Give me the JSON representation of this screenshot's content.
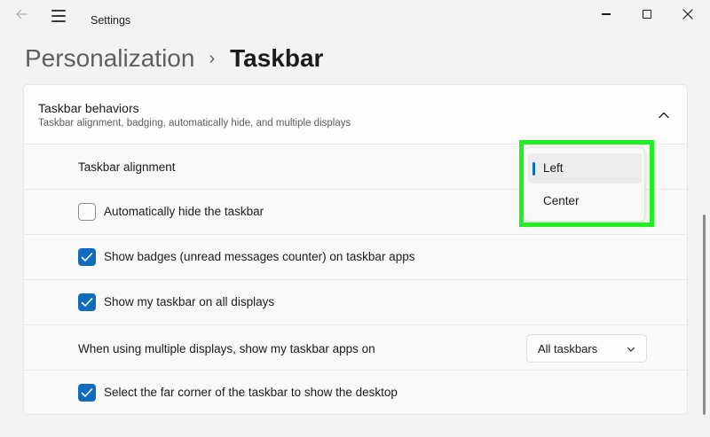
{
  "window": {
    "title": "Settings"
  },
  "breadcrumb": {
    "parent": "Personalization",
    "separator": "›",
    "current": "Taskbar"
  },
  "section": {
    "title": "Taskbar behaviors",
    "subtitle": "Taskbar alignment, badging, automatically hide, and multiple displays",
    "expanded": true
  },
  "rows": [
    {
      "label": "Taskbar alignment",
      "type": "dropdown"
    },
    {
      "label": "Automatically hide the taskbar",
      "type": "checkbox",
      "checked": false
    },
    {
      "label": "Show badges (unread messages counter) on taskbar apps",
      "type": "checkbox",
      "checked": true
    },
    {
      "label": "Show my taskbar on all displays",
      "type": "checkbox",
      "checked": true
    },
    {
      "label": "When using multiple displays, show my taskbar apps on",
      "type": "select",
      "value": "All taskbars"
    },
    {
      "label": "Select the far corner of the taskbar to show the desktop",
      "type": "checkbox",
      "checked": true
    }
  ],
  "alignment_dropdown": {
    "options": [
      "Left",
      "Center"
    ],
    "selected": "Left"
  },
  "icons": {
    "back": "back-arrow-icon",
    "menu": "hamburger-menu-icon",
    "minimize": "minimize-icon",
    "maximize": "maximize-icon",
    "close": "close-icon",
    "collapse": "chevron-up-icon",
    "select": "chevron-down-icon",
    "check": "checkmark-icon"
  },
  "colors": {
    "accent": "#0f6cbd",
    "highlight": "#22ee22",
    "background": "#f3f3f3"
  }
}
